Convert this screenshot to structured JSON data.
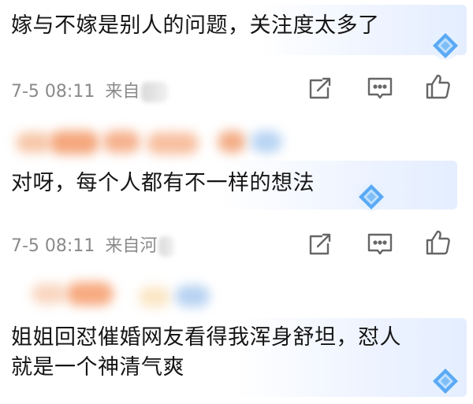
{
  "comments": [
    {
      "text_lines": [
        "嫁与不嫁是别人的问题，关注度太多了"
      ],
      "meta": {
        "date_time": "7-5 08:11",
        "source_prefix": "来自",
        "location": ""
      }
    },
    {
      "text_lines": [
        "对呀，每个人都有不一样的想法"
      ],
      "meta": {
        "date_time": "7-5 08:11",
        "source_prefix": "来自",
        "location": "河"
      }
    },
    {
      "text_lines": [
        "姐姐回怼催婚网友看得我浑身舒坦，怼人",
        "就是一个神清气爽"
      ]
    }
  ],
  "actions": {
    "share_icon": "share-icon",
    "comment_icon": "comment-icon",
    "like_icon": "thumbs-up-icon"
  },
  "colors": {
    "text": "#151515",
    "meta": "#8a8a8a",
    "icon": "#666666",
    "badge": "#5aa9f5"
  }
}
